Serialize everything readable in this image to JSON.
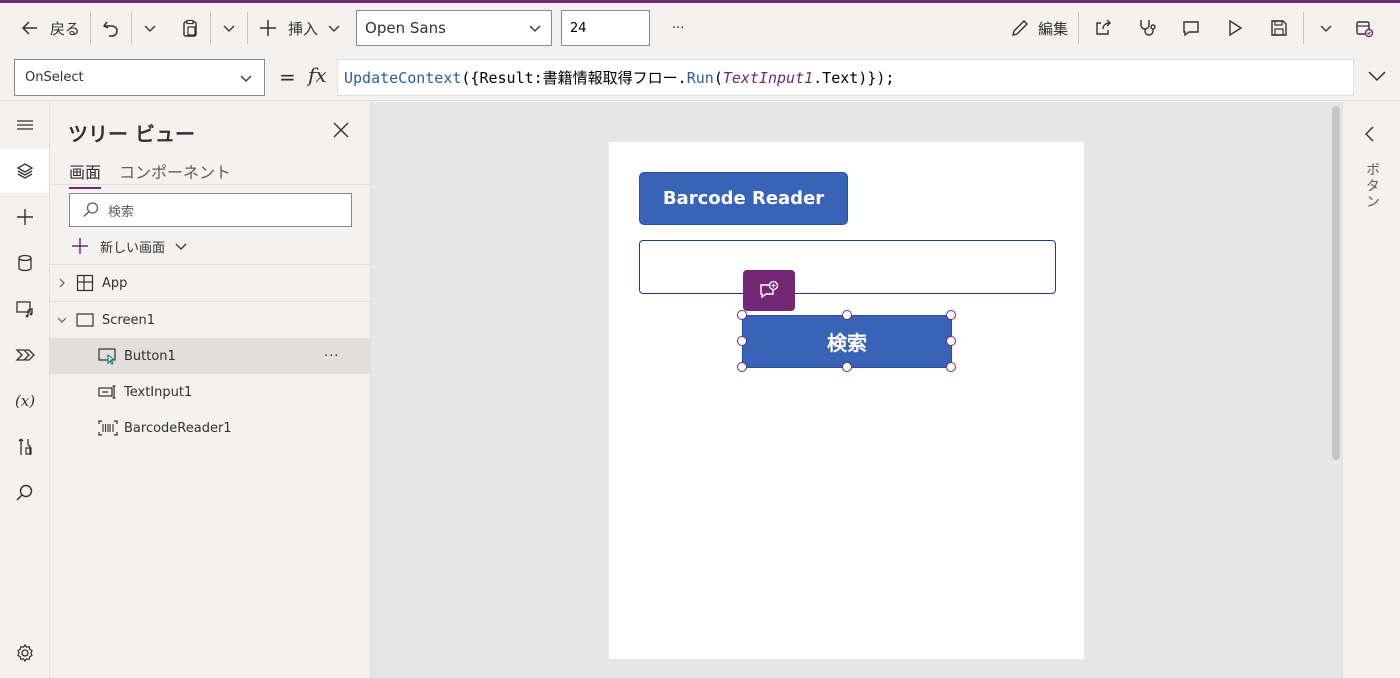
{
  "toolbar": {
    "back_label": "戻る",
    "insert_label": "挿入",
    "font_value": "Open Sans",
    "font_size_value": "24",
    "more_label": "···",
    "edit_label": "編集"
  },
  "formula_bar": {
    "property": "OnSelect",
    "equals": "=",
    "fx": "fx",
    "formula_parts": {
      "p1": "UpdateContext",
      "p2": "({Result:書籍情報取得フロー.",
      "p3": "Run",
      "p4": "(",
      "p5": "TextInput1",
      "p6": ".Text)});"
    }
  },
  "tree": {
    "title": "ツリー ビュー",
    "tabs": [
      "画面",
      "コンポーネント"
    ],
    "search_placeholder": "検索",
    "new_screen_label": "新しい画面",
    "items": [
      {
        "label": "App"
      },
      {
        "label": "Screen1"
      },
      {
        "label": "Button1"
      },
      {
        "label": "TextInput1"
      },
      {
        "label": "BarcodeReader1"
      }
    ],
    "row_more": "···"
  },
  "canvas": {
    "barcode_button_label": "Barcode Reader",
    "search_button_label": "検索"
  },
  "right_panel": {
    "label": "ボタン"
  },
  "colors": {
    "accent": "#742774",
    "button_fill": "#3863b6"
  }
}
